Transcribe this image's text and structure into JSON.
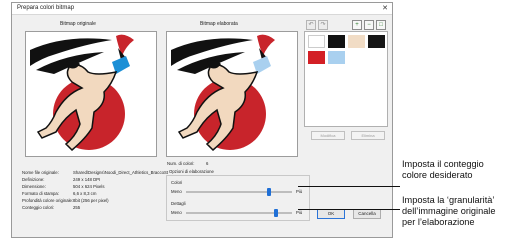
{
  "window": {
    "title": "Prepara colori bitmap"
  },
  "panels": {
    "original_label": "Bitmap originale",
    "processed_label": "Bitmap elaborata"
  },
  "toolbar": {
    "undo_icon": "undo-icon",
    "redo_icon": "redo-icon"
  },
  "zoom": {
    "zoom_in": "+",
    "zoom_out": "−",
    "zoom_fit": "□"
  },
  "palette": {
    "swatches": [
      "#ffffff",
      "#111111",
      "#f1dcc5",
      "#151515",
      "#d31f25",
      "#a9d0ef"
    ],
    "modify_button": "Modifica",
    "delete_button": "Elimina"
  },
  "num_colors": {
    "label": "Num. di colori:",
    "value": "6"
  },
  "info": [
    {
      "label": "Nome file originale:",
      "value": "Shared\\Designs\\Noodi_Direct_Athletics_BraccoStr..."
    },
    {
      "label": "Definizione:",
      "value": "249 x 148 DPI"
    },
    {
      "label": "Dimensione:",
      "value": "504 x 624 Pixels"
    },
    {
      "label": "Formato di stampa:",
      "value": "6,6 x 8,3 cm"
    },
    {
      "label": "Profondità colore originale:",
      "value": "8bit (256 per pixel)"
    },
    {
      "label": "Conteggio colori:",
      "value": "255"
    }
  ],
  "options": {
    "title": "Opzioni di elaborazione",
    "colors_label": "Colori",
    "details_label": "Dettagli",
    "less": "Meno",
    "more": "Più",
    "colors_level": 0.78,
    "details_level": 0.85
  },
  "buttons": {
    "ok": "OK",
    "cancel": "Cancella"
  },
  "callouts": {
    "colors": "Imposta il conteggio\ncolore desiderato",
    "granularity": "Imposta la ‘granularità’\ndell’immagine originale\nper l’elaborazione"
  }
}
